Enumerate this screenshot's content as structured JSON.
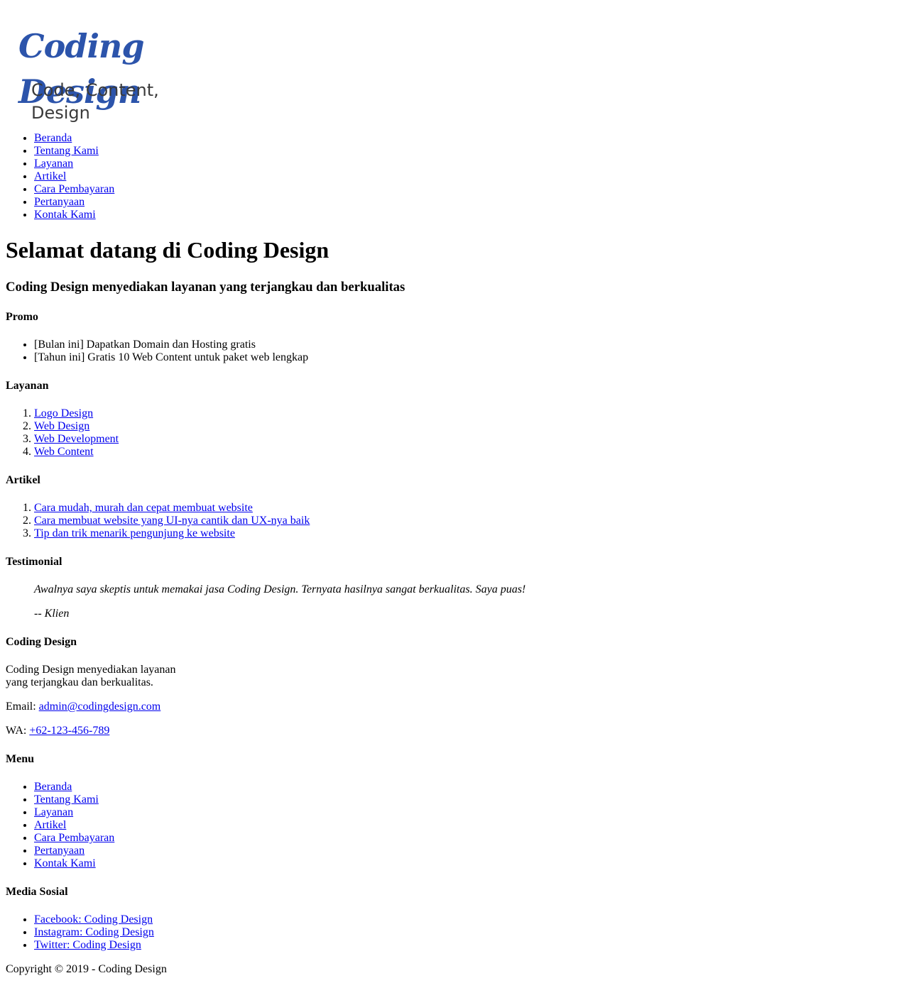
{
  "brand": {
    "logo_title": "Coding Design",
    "logo_tagline": "Code, Content, Design",
    "color": "#2c54ab"
  },
  "nav": {
    "items": [
      {
        "label": "Beranda"
      },
      {
        "label": "Tentang Kami"
      },
      {
        "label": "Layanan"
      },
      {
        "label": "Artikel"
      },
      {
        "label": "Cara Pembayaran"
      },
      {
        "label": "Pertanyaan"
      },
      {
        "label": "Kontak Kami"
      }
    ]
  },
  "hero": {
    "title": "Selamat datang di Coding Design",
    "subtitle": "Coding Design menyediakan layanan yang terjangkau dan berkualitas"
  },
  "promo": {
    "heading": "Promo",
    "items": [
      {
        "label": "[Bulan ini] Dapatkan Domain dan Hosting gratis"
      },
      {
        "label": "[Tahun ini] Gratis 10 Web Content untuk paket web lengkap"
      }
    ]
  },
  "services": {
    "heading": "Layanan",
    "items": [
      {
        "label": "Logo Design"
      },
      {
        "label": "Web Design"
      },
      {
        "label": "Web Development"
      },
      {
        "label": "Web Content"
      }
    ]
  },
  "articles": {
    "heading": "Artikel",
    "items": [
      {
        "label": "Cara mudah, murah dan cepat membuat website"
      },
      {
        "label": "Cara membuat website yang UI-nya cantik dan UX-nya baik"
      },
      {
        "label": "Tip dan trik menarik pengunjung ke website"
      }
    ]
  },
  "testimonial": {
    "heading": "Testimonial",
    "quote": "Awalnya saya skeptis untuk memakai jasa Coding Design. Ternyata hasilnya sangat berkualitas. Saya puas!",
    "author": "-- Klien"
  },
  "about": {
    "heading": "Coding Design",
    "line1": "Coding Design menyediakan layanan",
    "line2": "yang terjangkau dan berkualitas.",
    "email_label": "Email:",
    "email": "admin@codingdesign.com",
    "wa_label": "WA:",
    "wa": "+62-123-456-789"
  },
  "footer_menu": {
    "heading": "Menu",
    "items": [
      {
        "label": "Beranda"
      },
      {
        "label": "Tentang Kami"
      },
      {
        "label": "Layanan"
      },
      {
        "label": "Artikel"
      },
      {
        "label": "Cara Pembayaran"
      },
      {
        "label": "Pertanyaan"
      },
      {
        "label": "Kontak Kami"
      }
    ]
  },
  "social": {
    "heading": "Media Sosial",
    "items": [
      {
        "label": "Facebook: Coding Design"
      },
      {
        "label": "Instagram: Coding Design"
      },
      {
        "label": "Twitter: Coding Design"
      }
    ]
  },
  "copyright": "Copyright © 2019 - Coding Design"
}
